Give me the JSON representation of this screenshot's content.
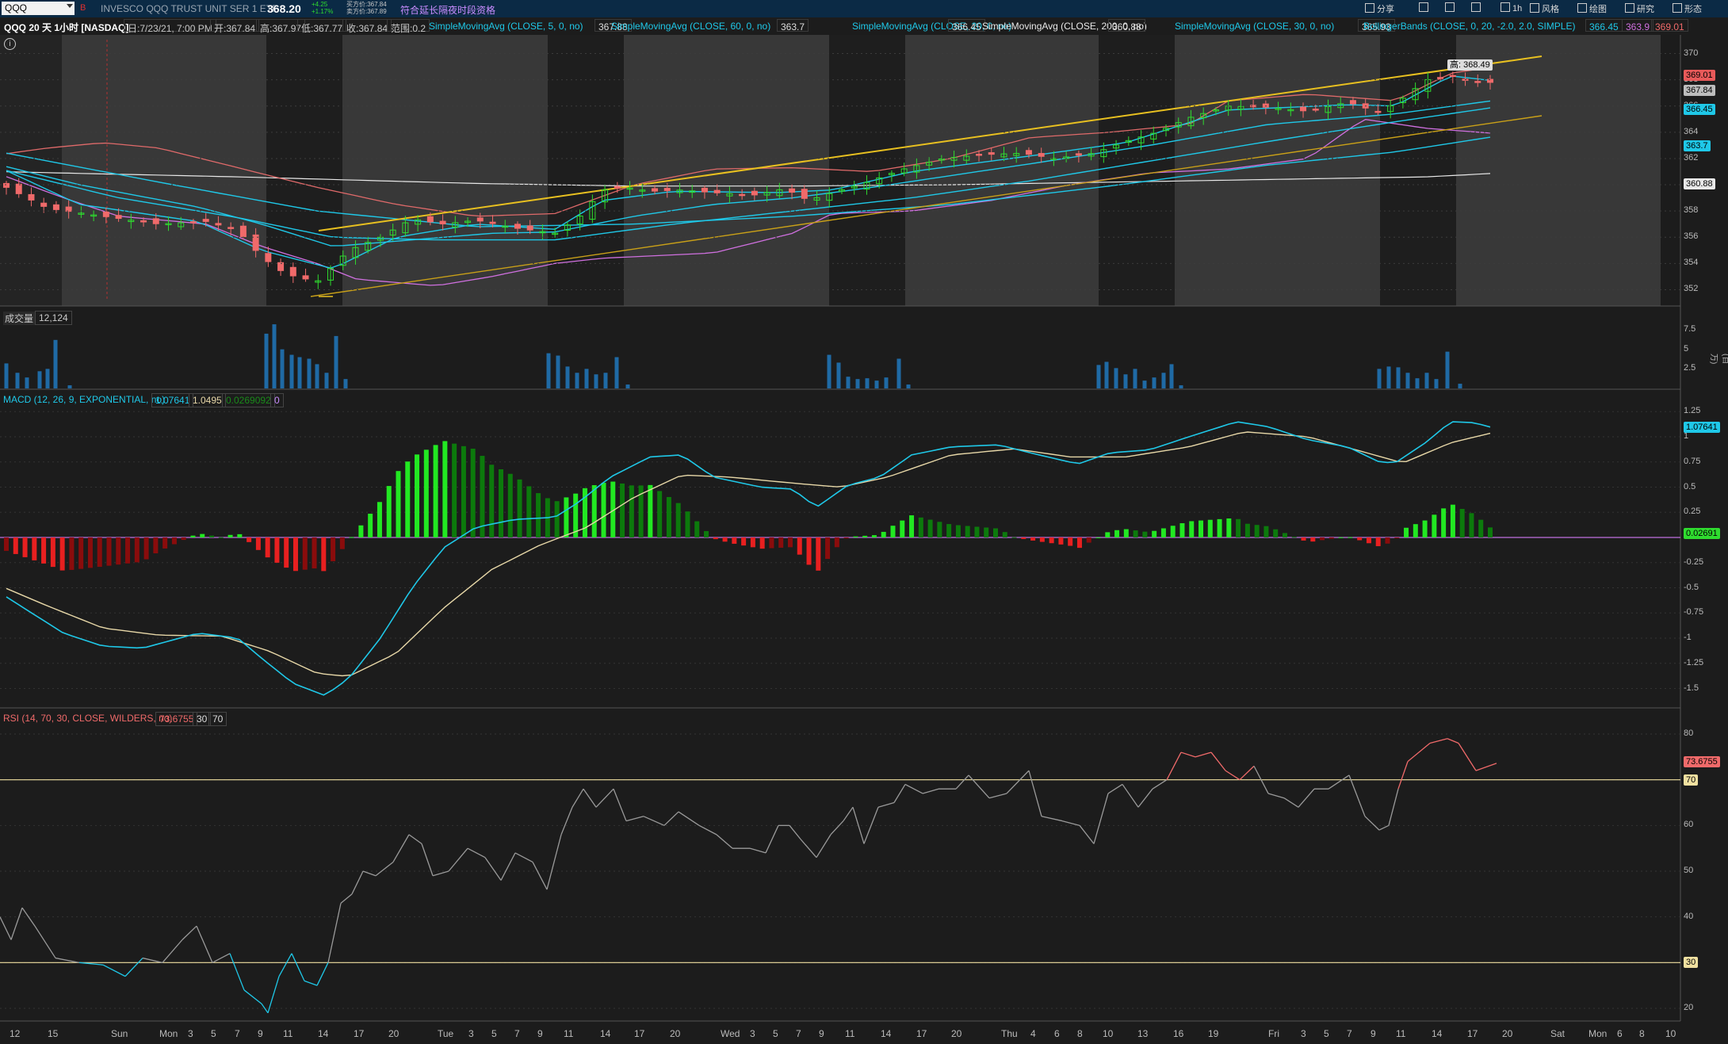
{
  "header": {
    "symbol": "QQQ",
    "flag": "B",
    "name": "INVESCO QQQ TRUST UNIT SER 1 ETF",
    "last": "368.20",
    "chg_abs": "+4.25",
    "chg_pct": "+1.17%",
    "bid": "买方价:367.84",
    "ask": "卖方价:367.89",
    "extended": "符合延长隔夜时段资格",
    "right_buttons": [
      {
        "icon": "share-icon",
        "label": "分享"
      },
      {
        "icon": "grid-icon",
        "label": ""
      },
      {
        "icon": "flask-icon",
        "label": ""
      },
      {
        "icon": "gear-icon",
        "label": ""
      },
      {
        "icon": "timeframe",
        "label": "1h"
      },
      {
        "icon": "style-icon",
        "label": "风格"
      },
      {
        "icon": "draw-icon",
        "label": "绘图"
      },
      {
        "icon": "study-icon",
        "label": "研究"
      },
      {
        "icon": "pattern-icon",
        "label": "形态"
      }
    ]
  },
  "legend": {
    "title": "QQQ 20 天 1小时 [NASDAQ]",
    "date": "日:7/23/21, 7:00 PM",
    "open": "开:367.84",
    "high": "高:367.97",
    "low": "低:367.77",
    "close": "收:367.84",
    "range": "范围:0.2",
    "studies": [
      {
        "label": "SimpleMovingAvg (CLOSE, 5, 0, no)",
        "value": "367.88",
        "color": "#1fc8e8"
      },
      {
        "label": "SimpleMovingAvg (CLOSE, 60, 0, no)",
        "value": "363.7",
        "color": "#1fc8e8"
      },
      {
        "label": "SimpleMovingAvg (CLOSE, 20, 0, no)",
        "value": "366.45",
        "color": "#1fc8e8"
      },
      {
        "label": "SimpleMovingAvg (CLOSE, 200, 0, no)",
        "value": "360.88",
        "color": "#e8e8e8"
      },
      {
        "label": "SimpleMovingAvg (CLOSE, 30, 0, no)",
        "value": "365.93",
        "color": "#1fc8e8"
      }
    ],
    "bollinger": {
      "label": "BollingerBands (CLOSE, 0, 20, -2.0, 2.0, SIMPLE)",
      "v1": "366.45",
      "v2": "363.9",
      "v3": "369.01"
    }
  },
  "price_pane": {
    "y_ticks": [
      "370",
      "368",
      "366",
      "364",
      "362",
      "360",
      "358",
      "356",
      "354",
      "352"
    ],
    "tags": [
      {
        "text": "369.01",
        "color": "#e85a5a"
      },
      {
        "text": "367.84",
        "color": "#bdbdbd"
      },
      {
        "text": "366.45",
        "color": "#1fc8e8"
      },
      {
        "text": "363.7",
        "color": "#1fc8e8"
      },
      {
        "text": "360.88",
        "color": "#e8e8e8"
      }
    ],
    "high_callout": "高: 368.49"
  },
  "volume_pane": {
    "label": "成交量",
    "value": "12,124",
    "y_ticks": [
      "7.5",
      "5",
      "2.5"
    ],
    "unit": "(百万)"
  },
  "macd_pane": {
    "label": "MACD (12, 26, 9, EXPONENTIAL, no)",
    "value": "1.07641",
    "avg": "1.0495",
    "diff": "0.0269092",
    "zero": "0",
    "y_ticks": [
      "1.25",
      "1",
      "0.75",
      "0.5",
      "0.25",
      "0",
      "-0.25",
      "-0.5",
      "-0.75",
      "-1",
      "-1.25",
      "-1.5"
    ],
    "tags": [
      {
        "text": "1.07641",
        "color": "#1fc8e8"
      },
      {
        "text": "0.02691",
        "color": "#2fdc2f"
      }
    ]
  },
  "rsi_pane": {
    "label": "RSI (14, 70, 30, CLOSE, WILDERS, no)",
    "value": "73.6755",
    "oversold": "30",
    "overbought": "70",
    "y_ticks": [
      "80",
      "70",
      "60",
      "50",
      "40",
      "30",
      "20"
    ],
    "tag_value": "73.6755",
    "tag_70": "70",
    "tag_30": "30"
  },
  "x_axis": [
    {
      "t": "12",
      "x": 18
    },
    {
      "t": "15",
      "x": 66
    },
    {
      "t": "Sun",
      "x": 146
    },
    {
      "t": "Mon",
      "x": 207
    },
    {
      "t": "3",
      "x": 243
    },
    {
      "t": "5",
      "x": 272
    },
    {
      "t": "7",
      "x": 302
    },
    {
      "t": "9",
      "x": 331
    },
    {
      "t": "11",
      "x": 363
    },
    {
      "t": "14",
      "x": 407
    },
    {
      "t": "17",
      "x": 452
    },
    {
      "t": "20",
      "x": 496
    },
    {
      "t": "Tue",
      "x": 558
    },
    {
      "t": "3",
      "x": 597
    },
    {
      "t": "5",
      "x": 626
    },
    {
      "t": "7",
      "x": 655
    },
    {
      "t": "9",
      "x": 684
    },
    {
      "t": "11",
      "x": 717
    },
    {
      "t": "14",
      "x": 763
    },
    {
      "t": "17",
      "x": 806
    },
    {
      "t": "20",
      "x": 851
    },
    {
      "t": "Wed",
      "x": 915
    },
    {
      "t": "3",
      "x": 952
    },
    {
      "t": "5",
      "x": 981
    },
    {
      "t": "7",
      "x": 1010
    },
    {
      "t": "9",
      "x": 1039
    },
    {
      "t": "11",
      "x": 1072
    },
    {
      "t": "14",
      "x": 1117
    },
    {
      "t": "17",
      "x": 1162
    },
    {
      "t": "20",
      "x": 1206
    },
    {
      "t": "Thu",
      "x": 1269
    },
    {
      "t": "4",
      "x": 1306
    },
    {
      "t": "6",
      "x": 1336
    },
    {
      "t": "8",
      "x": 1365
    },
    {
      "t": "10",
      "x": 1397
    },
    {
      "t": "13",
      "x": 1441
    },
    {
      "t": "16",
      "x": 1486
    },
    {
      "t": "19",
      "x": 1530
    },
    {
      "t": "Fri",
      "x": 1606
    },
    {
      "t": "3",
      "x": 1647
    },
    {
      "t": "5",
      "x": 1676
    },
    {
      "t": "7",
      "x": 1705
    },
    {
      "t": "9",
      "x": 1735
    },
    {
      "t": "11",
      "x": 1767
    },
    {
      "t": "14",
      "x": 1812
    },
    {
      "t": "17",
      "x": 1857
    },
    {
      "t": "20",
      "x": 1901
    },
    {
      "t": "Sat",
      "x": 1962
    },
    {
      "t": "Mon",
      "x": 2010
    },
    {
      "t": "6",
      "x": 2046
    },
    {
      "t": "8",
      "x": 2074
    },
    {
      "t": "10",
      "x": 2107
    }
  ],
  "colors": {
    "up": "#2fdc2f",
    "down": "#f06a6a",
    "ma": "#1fc8e8",
    "bb_upper": "#e06a6a",
    "bb_lower": "#d070e0",
    "sma200": "#e8e8e8",
    "trend": "#e8c020"
  }
}
